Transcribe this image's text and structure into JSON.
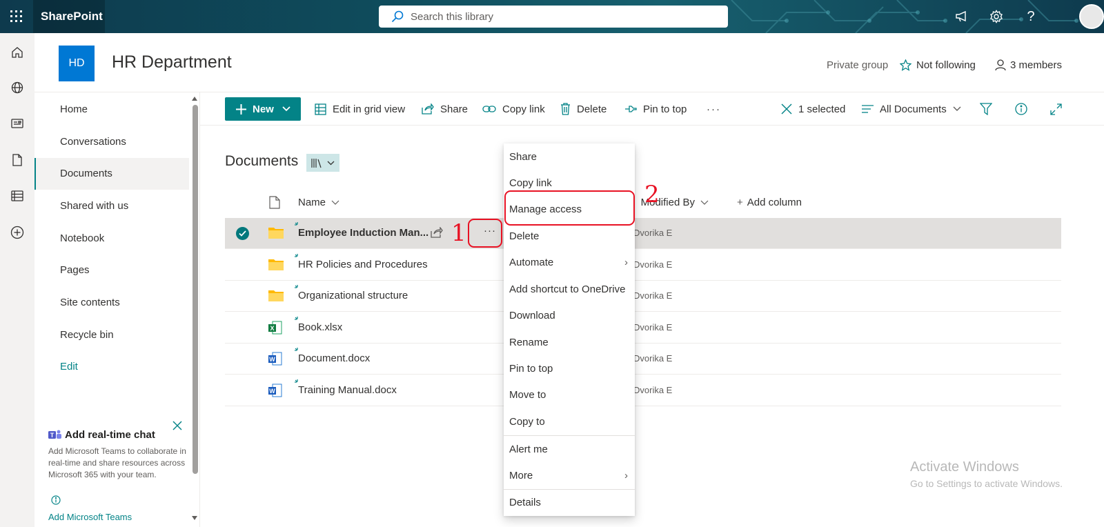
{
  "topbar": {
    "app_name": "SharePoint",
    "search_placeholder": "Search this library",
    "icons": [
      "waffle-icon",
      "megaphone-icon",
      "gear-icon",
      "help-icon",
      "avatar"
    ]
  },
  "site": {
    "logo_initials": "HD",
    "title": "HR Department",
    "group_type": "Private group",
    "follow_label": "Not following",
    "members_label": "3 members"
  },
  "nav": {
    "items": [
      "Home",
      "Conversations",
      "Documents",
      "Shared with us",
      "Notebook",
      "Pages",
      "Site contents",
      "Recycle bin"
    ],
    "active": "Documents",
    "edit_label": "Edit"
  },
  "chat_card": {
    "title": "Add real-time chat",
    "description": "Add Microsoft Teams to collaborate in real-time and share resources across Microsoft 365 with your team.",
    "link_partial": "Add Microsoft Teams"
  },
  "commandbar": {
    "new_label": "New",
    "edit_grid_label": "Edit in grid view",
    "share_label": "Share",
    "copy_link_label": "Copy link",
    "delete_label": "Delete",
    "pin_label": "Pin to top",
    "more_label": "···",
    "selected_label": "1 selected",
    "view_label": "All Documents"
  },
  "library": {
    "title": "Documents",
    "columns": {
      "name": "Name",
      "modified_by": "Modified By",
      "add_column": "Add column"
    },
    "rows": [
      {
        "name": "Employee Induction Man...",
        "type": "folder",
        "modified_by": "Dvorika E",
        "selected": true
      },
      {
        "name": "HR Policies and Procedures",
        "type": "folder",
        "modified_by": "Dvorika E"
      },
      {
        "name": "Organizational structure",
        "type": "folder",
        "modified_by": "Dvorika E"
      },
      {
        "name": "Book.xlsx",
        "type": "excel",
        "modified_by": "Dvorika E"
      },
      {
        "name": "Document.docx",
        "type": "word",
        "modified_by": "Dvorika E"
      },
      {
        "name": "Training Manual.docx",
        "type": "word",
        "modified_by": "Dvorika E"
      }
    ]
  },
  "context_menu": {
    "items": [
      "Share",
      "Copy link",
      "Manage access",
      "Delete",
      "Automate",
      "Add shortcut to OneDrive",
      "Download",
      "Rename",
      "Pin to top",
      "Move to",
      "Copy to",
      "Alert me",
      "More",
      "Details"
    ]
  },
  "annotations": {
    "step1": "1",
    "step2": "2",
    "color": "#e81123"
  },
  "watermark": {
    "line1": "Activate Windows",
    "line2": "Go to Settings to activate Windows."
  },
  "colors": {
    "accent": "#038387",
    "suite_bar": "#0e3a4d",
    "site_logo": "#0078d4"
  }
}
